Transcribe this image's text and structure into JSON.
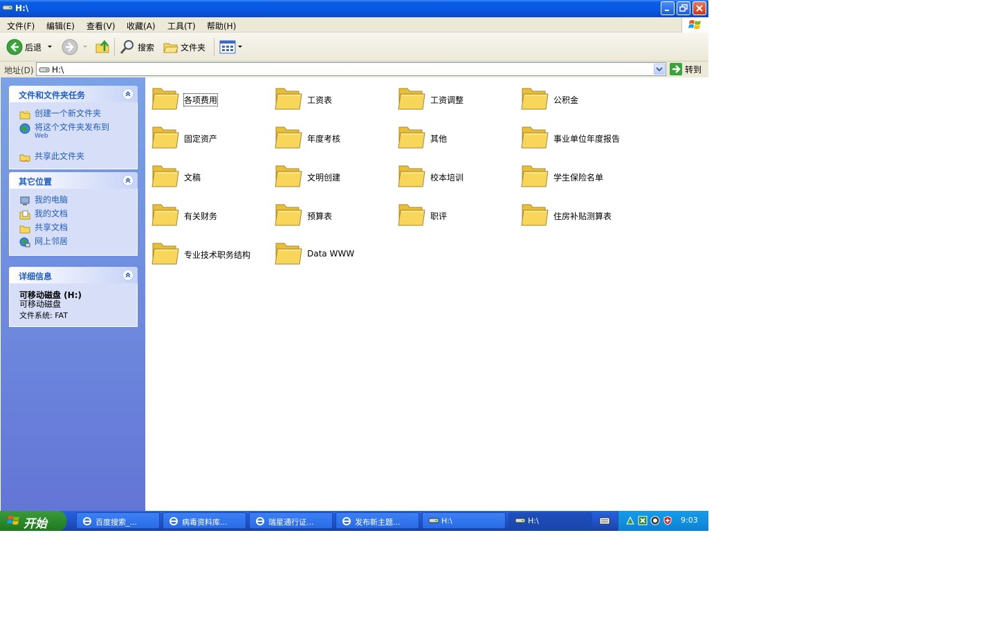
{
  "window": {
    "title": "H:\\",
    "buttons": [
      "minimize",
      "restore",
      "close"
    ]
  },
  "menu": [
    {
      "label": "文件(F)"
    },
    {
      "label": "编辑(E)"
    },
    {
      "label": "查看(V)"
    },
    {
      "label": "收藏(A)"
    },
    {
      "label": "工具(T)"
    },
    {
      "label": "帮助(H)"
    }
  ],
  "toolbar": {
    "back_label": "后退",
    "search_label": "搜索",
    "folders_label": "文件夹"
  },
  "address": {
    "label": "地址(D)",
    "value": "H:\\",
    "go_label": "转到"
  },
  "tasks_panel": {
    "title": "文件和文件夹任务",
    "items": [
      {
        "label": "创建一个新文件夹",
        "icon": "new-folder-icon"
      },
      {
        "label": "将这个文件夹发布到",
        "sub": "Web",
        "icon": "publish-web-icon"
      },
      {
        "label": "共享此文件夹",
        "icon": "share-folder-icon"
      }
    ]
  },
  "places_panel": {
    "title": "其它位置",
    "items": [
      {
        "label": "我的电脑",
        "icon": "my-computer-icon"
      },
      {
        "label": "我的文档",
        "icon": "my-documents-icon"
      },
      {
        "label": "共享文档",
        "icon": "shared-documents-icon"
      },
      {
        "label": "网上邻居",
        "icon": "network-places-icon"
      }
    ]
  },
  "details_panel": {
    "title": "详细信息",
    "name": "可移动磁盘 (H:)",
    "type": "可移动磁盘",
    "fs": "文件系统: FAT"
  },
  "folders": [
    {
      "name": "各项费用",
      "selected": true
    },
    {
      "name": "工资表"
    },
    {
      "name": "工资调整"
    },
    {
      "name": "公积金"
    },
    {
      "name": "固定资产"
    },
    {
      "name": "年度考核"
    },
    {
      "name": "其他"
    },
    {
      "name": "事业单位年度报告"
    },
    {
      "name": "文稿"
    },
    {
      "name": "文明创建"
    },
    {
      "name": "校本培训"
    },
    {
      "name": "学生保险名单"
    },
    {
      "name": "有关财务"
    },
    {
      "name": "预算表"
    },
    {
      "name": "职评"
    },
    {
      "name": "住房补贴测算表"
    },
    {
      "name": "专业技术职务结构"
    },
    {
      "name": "Data WWW"
    }
  ],
  "taskbar": {
    "start_label": "开始",
    "tasks": [
      {
        "label": "百度搜索_...",
        "icon": "ie-icon"
      },
      {
        "label": "病毒资料库...",
        "icon": "ie-icon"
      },
      {
        "label": "瑞星通行证...",
        "icon": "ie-icon"
      },
      {
        "label": "发布新主题...",
        "icon": "ie-icon"
      },
      {
        "label": "H:\\",
        "icon": "drive-icon"
      },
      {
        "label": "H:\\",
        "icon": "drive-icon",
        "active": true
      }
    ],
    "clock": "9:03"
  },
  "colors": {
    "title_blue": "#0a5ce8",
    "taskpane_top": "#7ba2e7",
    "taskpane_bottom": "#6375d6",
    "link_blue": "#215dc6",
    "folder_yellow": "#f7d65a",
    "start_green": "#2b8a2b",
    "tray_blue": "#1290e0"
  }
}
